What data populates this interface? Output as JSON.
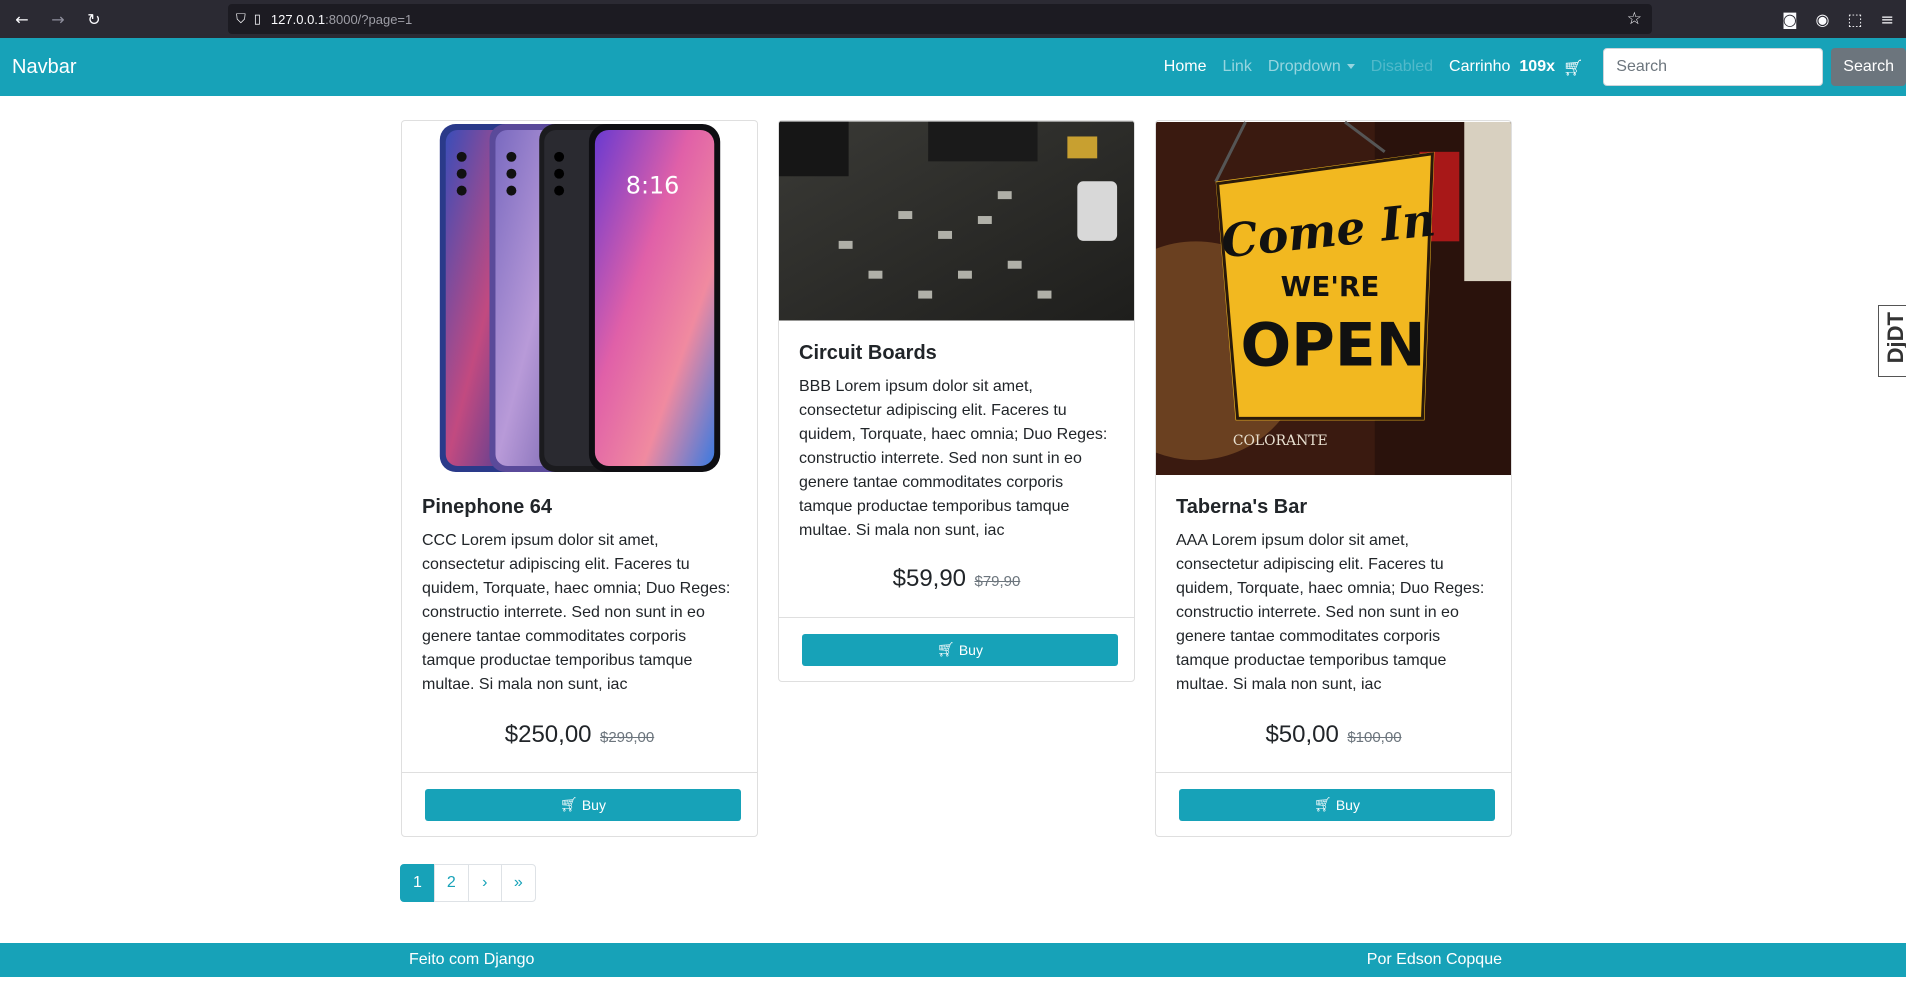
{
  "browser": {
    "url_host": "127.0.0.1",
    "url_rest": ":8000/?page=1"
  },
  "navbar": {
    "brand": "Navbar",
    "links": [
      {
        "label": "Home",
        "state": "active"
      },
      {
        "label": "Link",
        "state": "normal"
      },
      {
        "label": "Dropdown",
        "state": "dropdown"
      },
      {
        "label": "Disabled",
        "state": "disabled"
      }
    ],
    "cart_label": "Carrinho",
    "cart_count": "109x",
    "search_placeholder": "Search",
    "search_button": "Search"
  },
  "products": [
    {
      "title": "Pinephone 64",
      "description": "CCC Lorem ipsum dolor sit amet, consectetur adipiscing elit. Faceres tu quidem, Torquate, haec omnia; Duo Reges: constructio interrete. Sed non sunt in eo genere tantae commoditates corporis tamque productae temporibus tamque multae. Si mala non sunt, iac",
      "price": "$250,00",
      "old_price": "$299,00",
      "buy_label": "Buy",
      "image": "smartphones-image"
    },
    {
      "title": "Circuit Boards",
      "description": "BBB Lorem ipsum dolor sit amet, consectetur adipiscing elit. Faceres tu quidem, Torquate, haec omnia; Duo Reges: constructio interrete. Sed non sunt in eo genere tantae commoditates corporis tamque productae temporibus tamque multae. Si mala non sunt, iac",
      "price": "$59,90",
      "old_price": "$79,90",
      "buy_label": "Buy",
      "image": "circuit-board-image"
    },
    {
      "title": "Taberna's Bar",
      "description": "AAA Lorem ipsum dolor sit amet, consectetur adipiscing elit. Faceres tu quidem, Torquate, haec omnia; Duo Reges: constructio interrete. Sed non sunt in eo genere tantae commoditates corporis tamque productae temporibus tamque multae. Si mala non sunt, iac",
      "price": "$50,00",
      "old_price": "$100,00",
      "buy_label": "Buy",
      "image": "open-sign-image",
      "sign_text": [
        "Come In",
        "WE'RE",
        "OPEN",
        "COLORANTE"
      ]
    }
  ],
  "pagination": {
    "items": [
      "1",
      "2",
      "›",
      "»"
    ],
    "current": "1"
  },
  "footer": {
    "left": "Feito com Django",
    "right": "Por Edson Copque"
  },
  "side_tab": "DjDT",
  "colors": {
    "primary": "#17a2b8",
    "secondary": "#6c757d",
    "browser_chrome": "#2b2a33"
  }
}
